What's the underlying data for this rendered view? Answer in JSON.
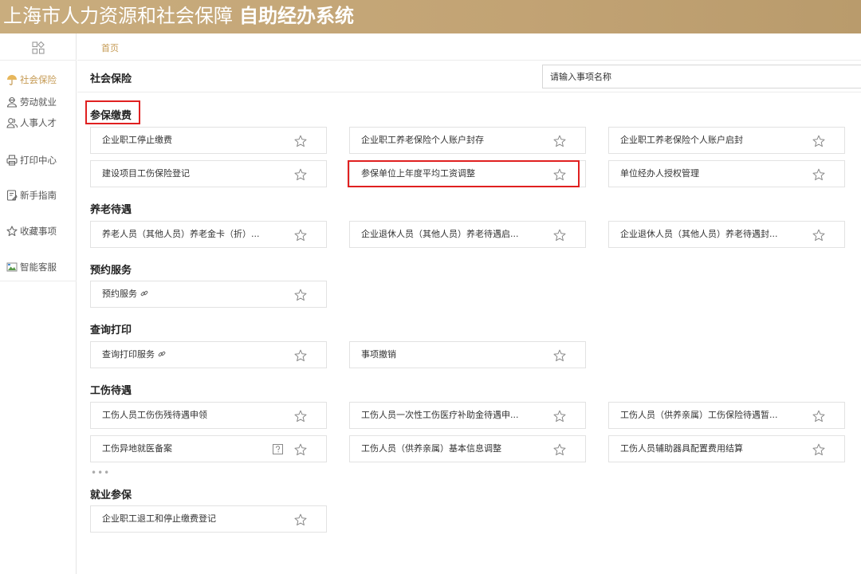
{
  "app": {
    "title_prefix": "上海市人力资源和社会保障",
    "title_bold": "自助经办系统"
  },
  "breadcrumb": {
    "home": "首页"
  },
  "sidebar": {
    "items": [
      {
        "label": "社会保险",
        "icon": "umbrella-icon",
        "active": true
      },
      {
        "label": "劳动就业",
        "icon": "worker-icon",
        "active": false
      },
      {
        "label": "人事人才",
        "icon": "people-icon",
        "active": false
      },
      {
        "label": "打印中心",
        "icon": "printer-icon",
        "active": false
      },
      {
        "label": "新手指南",
        "icon": "guide-icon",
        "active": false
      },
      {
        "label": "收藏事项",
        "icon": "star-icon",
        "active": false
      },
      {
        "label": "智能客服",
        "icon": "chat-icon",
        "active": false
      }
    ]
  },
  "section": {
    "title": "社会保险"
  },
  "search": {
    "placeholder": "请输入事项名称"
  },
  "groups": {
    "g0": {
      "title": "参保缴费"
    },
    "g1": {
      "title": "养老待遇"
    },
    "g2": {
      "title": "预约服务"
    },
    "g3": {
      "title": "查询打印"
    },
    "g4": {
      "title": "工伤待遇"
    },
    "g5": {
      "title": "就业参保"
    }
  },
  "cards": {
    "c0": "企业职工停止缴费",
    "c1": "企业职工养老保险个人账户封存",
    "c2": "企业职工养老保险个人账户启封",
    "c3": "建设项目工伤保险登记",
    "c4": "参保单位上年度平均工资调整",
    "c5": "单位经办人授权管理",
    "c6": "养老人员（其他人员）养老金卡（折）...",
    "c7": "企业退休人员（其他人员）养老待遇启...",
    "c8": "企业退休人员（其他人员）养老待遇封...",
    "c9": "预约服务",
    "c10": "查询打印服务",
    "c11": "事项撤销",
    "c12": "工伤人员工伤伤残待遇申领",
    "c13": "工伤人员一次性工伤医疗补助金待遇申...",
    "c14": "工伤人员（供养亲属）工伤保险待遇暂...",
    "c15": "工伤异地就医备案",
    "c16": "工伤人员（供养亲属）基本信息调整",
    "c17": "工伤人员辅助器具配置费用结算",
    "c18": "企业职工退工和停止缴费登记"
  },
  "ellipsis": "•••",
  "colors": {
    "header": "#c4a676",
    "accent": "#c59a53",
    "highlight": "#e02020"
  }
}
